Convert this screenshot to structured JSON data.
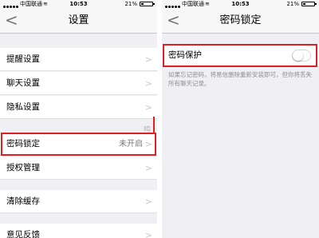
{
  "left": {
    "status": {
      "carrier": "中国联通",
      "time": "10:53",
      "battery": "21%",
      "battery_level": 0.21
    },
    "nav": {
      "title": "设置",
      "back": "<"
    },
    "rows": [
      {
        "label": "提醒设置",
        "value": ""
      },
      {
        "label": "聊天设置",
        "value": ""
      },
      {
        "label": "隐私设置",
        "value": ""
      },
      {
        "label": "密码锁定",
        "value": "未开启"
      },
      {
        "label": "授权管理",
        "value": ""
      },
      {
        "label": "清除缓存",
        "value": ""
      },
      {
        "label": "意见反馈",
        "value": ""
      }
    ],
    "ghost_text": "鸣",
    "chevron": ">"
  },
  "right": {
    "status": {
      "carrier": "中国联通",
      "time": "10:53",
      "battery": "21%",
      "battery_level": 0.21
    },
    "nav": {
      "title": "密码锁定",
      "back": "<"
    },
    "row": {
      "label": "密码保护",
      "enabled": false
    },
    "note": "如果忘记密码，将易信删除重新安装即可，但你将丢失所有聊天记录。"
  },
  "colors": {
    "highlight": "#e02020",
    "background": "#efeff4"
  }
}
